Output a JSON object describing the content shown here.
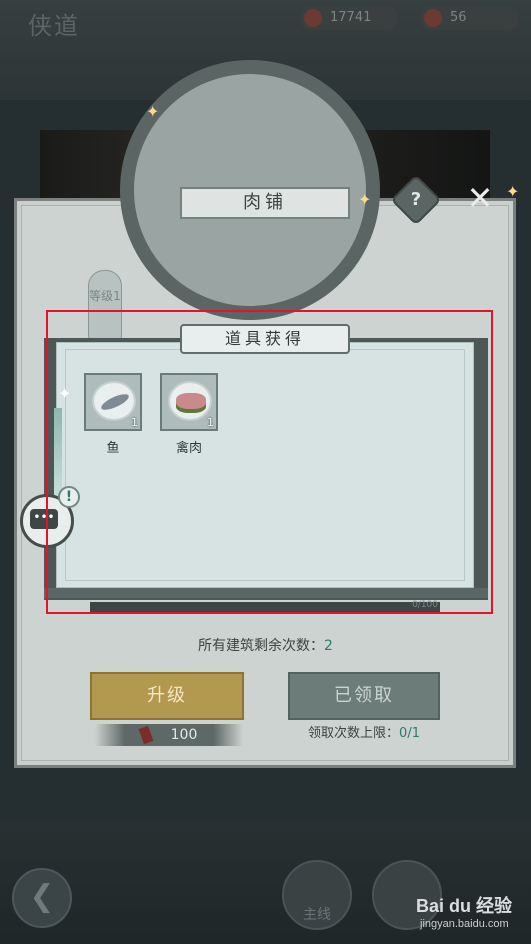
{
  "hud": {
    "title": "侠道",
    "copper": "17741",
    "tokens": "56"
  },
  "shop": {
    "title": "肉铺",
    "help": "?",
    "close": "✕",
    "level_tab": "等级1",
    "remaining_label": "所有建筑剩余次数：",
    "remaining_value": "2",
    "upgrade_label": "升级",
    "upgrade_cost": "100",
    "claimed_label": "已领取",
    "claim_limit_label": "领取次数上限：",
    "claim_limit_value": "0/1"
  },
  "dialog": {
    "title": "道具获得",
    "progress_text": "0/100",
    "items": [
      {
        "name": "鱼",
        "count": "1",
        "icon": "fish-icon"
      },
      {
        "name": "禽肉",
        "count": "1",
        "icon": "poultry-meat-icon"
      }
    ]
  },
  "chat": {
    "bubble": "•••",
    "alert": "!"
  },
  "bottom_nav": {
    "back": "❮",
    "main_quest": "主线",
    "other": ""
  },
  "watermark": {
    "brand": "Bai du 经验",
    "url": "jingyan.baidu.com"
  },
  "colors": {
    "accent_teal": "#2f7a6a",
    "upgrade_gold": "#b3994f",
    "highlight_red": "#e3142a"
  }
}
